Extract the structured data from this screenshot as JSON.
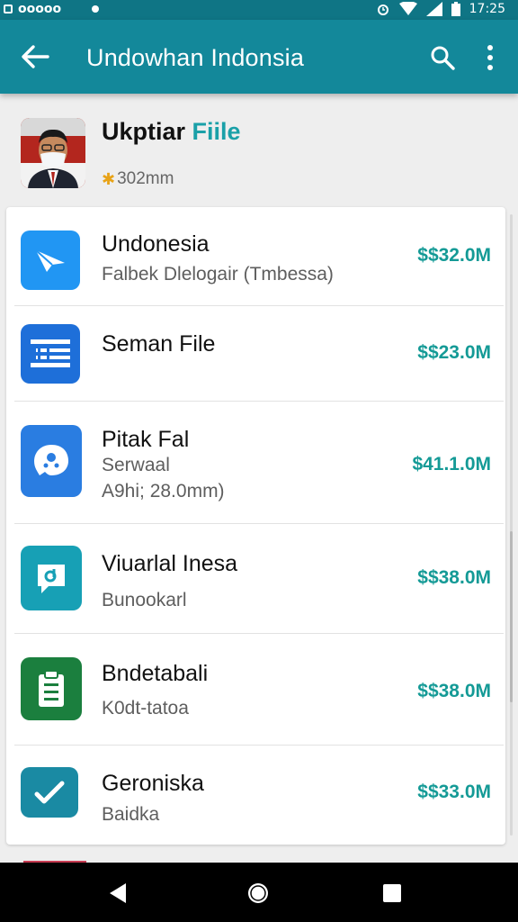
{
  "status_bar": {
    "left_text": "ooooo",
    "time": "17:25"
  },
  "app_bar": {
    "title": "Undowhan Indonsia",
    "icons": [
      "back-arrow-icon",
      "search-icon",
      "more-vert-icon"
    ]
  },
  "profile": {
    "name_main": "Ukptiar",
    "name_accent": "Fiile",
    "subtitle": "302mm",
    "star": "✱"
  },
  "items": [
    {
      "name": "Undonesia",
      "sub": [
        "Falbek Dlelogair (Tmbessa)"
      ],
      "price": "$$32.0M",
      "icon": "send-plane-icon",
      "icon_color": "#2196f3"
    },
    {
      "name": "Seman File",
      "sub": [],
      "price": "$$23.0M",
      "icon": "document-list-icon",
      "icon_color": "#1e6fd9"
    },
    {
      "name": "Pitak Fal",
      "sub": [
        "Serwaal",
        "A9hi; 28.0mm)"
      ],
      "price": "$41.1.0M",
      "icon": "chat-bubble-icon",
      "icon_color": "#2a7de1"
    },
    {
      "name": "Viuarlal Inesa",
      "sub": [
        "Bunookarl"
      ],
      "price": "$$38.0M",
      "icon": "message-icon",
      "icon_color": "#17a0b5"
    },
    {
      "name": "Bndetabali",
      "sub": [
        "K0dt-tatoa"
      ],
      "price": "$$38.0M",
      "icon": "clipboard-icon",
      "icon_color": "#1b7f3e"
    },
    {
      "name": "Geroniska",
      "sub": [
        "Baidka"
      ],
      "price": "$$33.0M",
      "icon": "check-edit-icon",
      "icon_color": "#1a8aa3"
    }
  ],
  "colors": {
    "status_bar": "#0f7585",
    "app_bar": "#13889a",
    "accent": "#1aa0a8",
    "price": "#149a96"
  }
}
